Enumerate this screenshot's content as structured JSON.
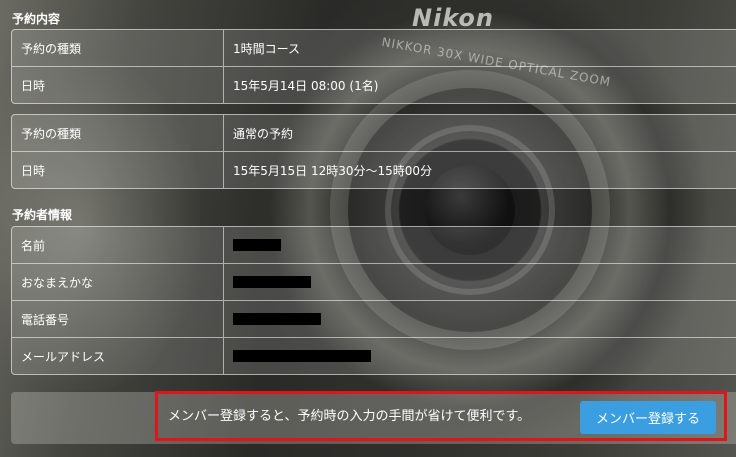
{
  "reservation_section": {
    "title": "予約内容",
    "bookings": [
      {
        "type_label": "予約の種類",
        "type_value": "1時間コース",
        "datetime_label": "日時",
        "datetime_value": "15年5月14日 08:00 (1名)"
      },
      {
        "type_label": "予約の種類",
        "type_value": "通常の予約",
        "datetime_label": "日時",
        "datetime_value": "15年5月15日 12時30分～15時00分"
      }
    ]
  },
  "customer_section": {
    "title": "予約者情報",
    "fields": [
      {
        "label": "名前"
      },
      {
        "label": "おなまえかな"
      },
      {
        "label": "電話番号"
      },
      {
        "label": "メールアドレス"
      }
    ]
  },
  "member_prompt": {
    "message": "メンバー登録すると、予約時の入力の手間が省けて便利です。",
    "button_label": "メンバー登録する"
  },
  "background": {
    "brand_text": "Nikon",
    "lens_text": "NIKKOR 30X WIDE OPTICAL ZOOM"
  },
  "colors": {
    "accent_button": "#3b9ee0",
    "highlight_border": "#e0151a"
  }
}
